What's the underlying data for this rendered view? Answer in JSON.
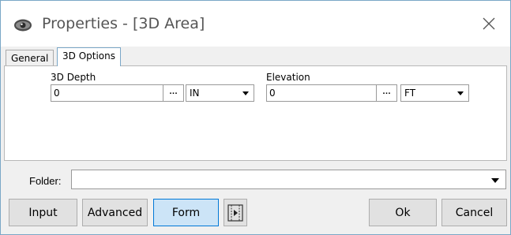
{
  "window": {
    "title": "Properties - [3D Area]"
  },
  "tabs": [
    {
      "label": "General",
      "active": false
    },
    {
      "label": "3D Options",
      "active": true
    }
  ],
  "depth": {
    "label": "3D Depth",
    "value": "0",
    "browse_label": "…",
    "unit": "IN"
  },
  "elevation": {
    "label": "Elevation",
    "value": "0",
    "browse_label": "…",
    "unit": "FT"
  },
  "folder": {
    "label": "Folder:",
    "value": ""
  },
  "buttons": {
    "input": "Input",
    "advanced": "Advanced",
    "form": "Form",
    "ok": "Ok",
    "cancel": "Cancel"
  },
  "icons": {
    "app": "eye-icon",
    "close": "close-icon",
    "toggle": "panel-toggle-icon"
  },
  "colors": {
    "accent": "#0078d7",
    "accent_fill": "#cce4f7",
    "window_border": "#7aa7c7"
  }
}
